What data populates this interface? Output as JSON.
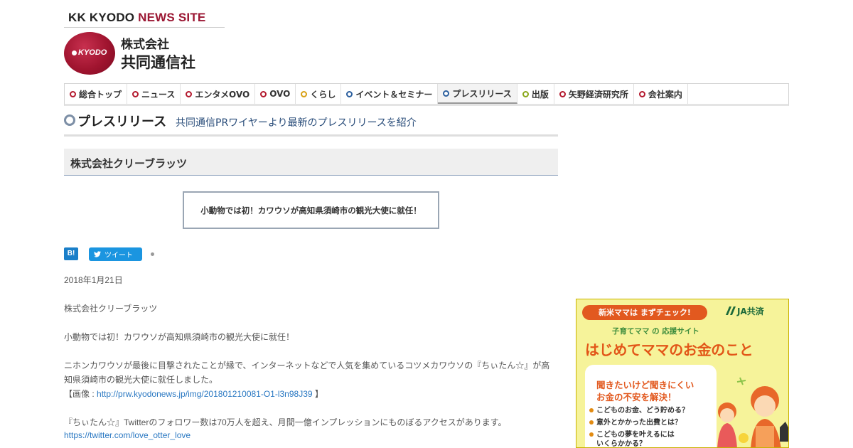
{
  "header": {
    "site_name_prefix": "KK KYODO ",
    "site_name_accent": "NEWS SITE",
    "logo_text": "KYODO",
    "company_line1": "株式会社",
    "company_line2": "共同通信社"
  },
  "nav": {
    "items": [
      {
        "label": "総合トップ",
        "dot_color": "#b3182d"
      },
      {
        "label": "ニュース",
        "dot_color": "#b3182d"
      },
      {
        "label": "エンタメOVO",
        "dot_color": "#b3182d"
      },
      {
        "label": "OVO",
        "dot_color": "#b3182d"
      },
      {
        "label": "くらし",
        "dot_color": "#d8a015"
      },
      {
        "label": "イベント＆セミナー",
        "dot_color": "#2b5f9e"
      },
      {
        "label": "プレスリリース",
        "dot_color": "#2b5f9e"
      },
      {
        "label": "出版",
        "dot_color": "#8aa81a"
      },
      {
        "label": "矢野経済研究所",
        "dot_color": "#b3182d"
      },
      {
        "label": "会社案内",
        "dot_color": "#b3182d"
      }
    ],
    "active_index": 6
  },
  "page": {
    "title": "プレスリリース",
    "subtitle": "共同通信PRワイヤーより最新のプレスリリースを紹介"
  },
  "release": {
    "company": "株式会社クリーブラッツ",
    "headline": "小動物では初！カワウソが高知県須崎市の観光大使に就任！",
    "hatena_label": "B!",
    "tweet_label": "ツイート",
    "date": "2018年1月21日",
    "body_company": "株式会社クリーブラッツ",
    "body_headline": "小動物では初！カワウソが高知県須崎市の観光大使に就任！",
    "para1_line1": "ニホンカワウソが最後に目撃されたことが縁で、インターネットなどで人気を集めているコツメカワウソの『ちぃたん☆』が高",
    "para1_line2": "知県須崎市の観光大使に就任しました。",
    "image_prefix": "【画像 :",
    "image_link": "http://prw.kyodonews.jp/img/201801210081-O1-l3n98J39",
    "image_suffix": "】",
    "para2": "『ちぃたん☆』Twitterのフォロワー数は70万人を超え、月間一億インプレッションにものぼるアクセスがあります。",
    "twitter_link": "https://twitter.com/love_otter_love"
  },
  "ad": {
    "pill": "新米ママは まずチェック!",
    "ja": "JA共済",
    "sub": "子育てママ の 応援サイト",
    "title": "はじめてママのお金のこと",
    "q1": "聞きたいけど聞きにくい",
    "q2": "お金の不安を解決！",
    "items": [
      "こどものお金、どう貯める？",
      "意外とかかった出費とは？",
      "こどもの夢を叶えるには",
      "いくらかかる？"
    ]
  }
}
